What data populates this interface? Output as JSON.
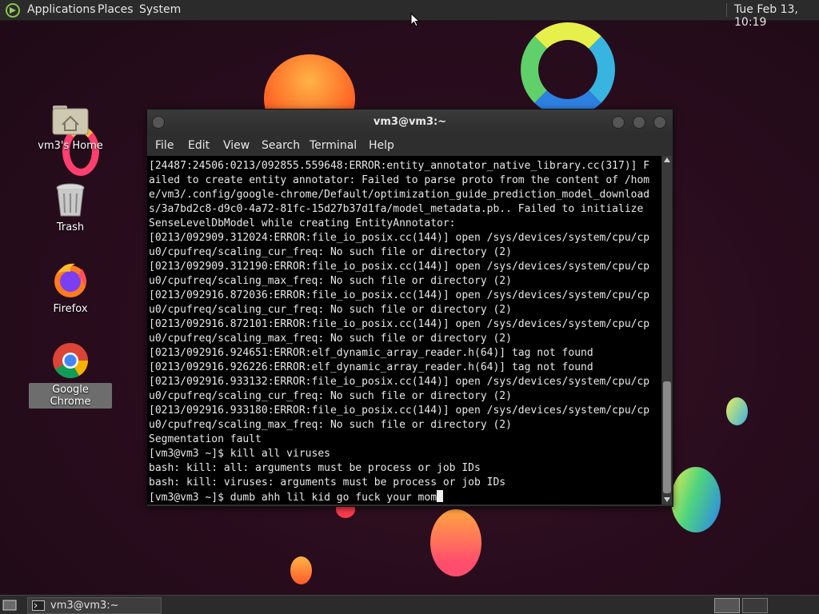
{
  "top_panel": {
    "menus": [
      "Applications",
      "Places",
      "System"
    ],
    "clock": "Tue Feb 13, 10:19"
  },
  "desktop_icons": {
    "home": "vm3's Home",
    "trash": "Trash",
    "firefox": "Firefox",
    "chrome": "Google Chrome"
  },
  "terminal": {
    "title": "vm3@vm3:~",
    "menu": [
      "File",
      "Edit",
      "View",
      "Search",
      "Terminal",
      "Help"
    ],
    "lines": [
      "[24487:24506:0213/092855.559648:ERROR:entity_annotator_native_library.cc(317)] F",
      "ailed to create entity annotator: Failed to parse proto from the content of /hom",
      "e/vm3/.config/google-chrome/Default/optimization_guide_prediction_model_download",
      "s/3a7bd2c8-d9c0-4a72-81fc-15d27b37d1fa/model_metadata.pb.. Failed to initialize",
      "SenseLevelDbModel while creating EntityAnnotator:",
      "[0213/092909.312024:ERROR:file_io_posix.cc(144)] open /sys/devices/system/cpu/cp",
      "u0/cpufreq/scaling_cur_freq: No such file or directory (2)",
      "[0213/092909.312190:ERROR:file_io_posix.cc(144)] open /sys/devices/system/cpu/cp",
      "u0/cpufreq/scaling_max_freq: No such file or directory (2)",
      "[0213/092916.872036:ERROR:file_io_posix.cc(144)] open /sys/devices/system/cpu/cp",
      "u0/cpufreq/scaling_cur_freq: No such file or directory (2)",
      "[0213/092916.872101:ERROR:file_io_posix.cc(144)] open /sys/devices/system/cpu/cp",
      "u0/cpufreq/scaling_max_freq: No such file or directory (2)",
      "[0213/092916.924651:ERROR:elf_dynamic_array_reader.h(64)] tag not found",
      "[0213/092916.926226:ERROR:elf_dynamic_array_reader.h(64)] tag not found",
      "[0213/092916.933132:ERROR:file_io_posix.cc(144)] open /sys/devices/system/cpu/cp",
      "u0/cpufreq/scaling_cur_freq: No such file or directory (2)",
      "[0213/092916.933180:ERROR:file_io_posix.cc(144)] open /sys/devices/system/cpu/cp",
      "u0/cpufreq/scaling_max_freq: No such file or directory (2)",
      "Segmentation fault",
      "[vm3@vm3 ~]$ kill all viruses",
      "bash: kill: all: arguments must be process or job IDs",
      "bash: kill: viruses: arguments must be process or job IDs"
    ],
    "prompt": "[vm3@vm3 ~]$ ",
    "input": "dumb ahh lil kid go fuck your mom"
  },
  "taskbar": {
    "window_label": "vm3@vm3:~"
  },
  "colors": {
    "panel": "#2b2b2b",
    "terminal_bg": "#000000",
    "terminal_fg": "#e8e8e8"
  }
}
